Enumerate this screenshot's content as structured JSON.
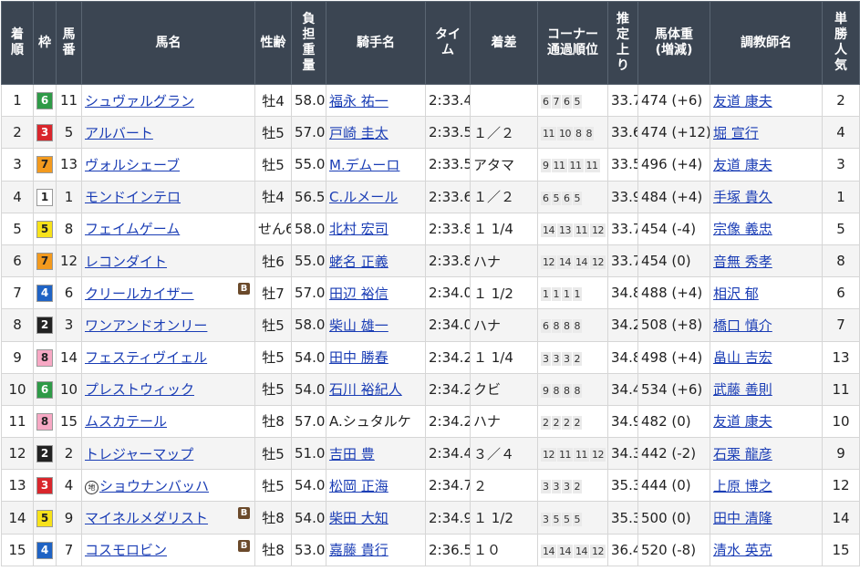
{
  "headers": [
    {
      "key": "rank",
      "lines": [
        "着",
        "順"
      ]
    },
    {
      "key": "waku",
      "lines": [
        "枠"
      ]
    },
    {
      "key": "umaban",
      "lines": [
        "馬",
        "番"
      ]
    },
    {
      "key": "horse",
      "lines": [
        "馬名"
      ]
    },
    {
      "key": "sexage",
      "lines": [
        "性齢"
      ]
    },
    {
      "key": "weight",
      "lines": [
        "負",
        "担",
        "重",
        "量"
      ]
    },
    {
      "key": "jockey",
      "lines": [
        "騎手名"
      ]
    },
    {
      "key": "time",
      "lines": [
        "タイ",
        "ム"
      ]
    },
    {
      "key": "margin",
      "lines": [
        "着差"
      ]
    },
    {
      "key": "corner",
      "lines": [
        "コーナー",
        "通過順位"
      ]
    },
    {
      "key": "last3f",
      "lines": [
        "推",
        "定",
        "上",
        "り"
      ]
    },
    {
      "key": "bodyweight",
      "lines": [
        "馬体重",
        "(増減)"
      ]
    },
    {
      "key": "trainer",
      "lines": [
        "調教師名"
      ]
    },
    {
      "key": "popularity",
      "lines": [
        "単",
        "勝",
        "人",
        "気"
      ]
    }
  ],
  "waku_colors": {
    "1": {
      "bg": "#ffffff",
      "fg": "#222222"
    },
    "2": {
      "bg": "#222222",
      "fg": "#ffffff"
    },
    "3": {
      "bg": "#d9262c",
      "fg": "#ffffff"
    },
    "4": {
      "bg": "#1f63c4",
      "fg": "#ffffff"
    },
    "5": {
      "bg": "#f7e21a",
      "fg": "#222222"
    },
    "6": {
      "bg": "#2e9a47",
      "fg": "#ffffff"
    },
    "7": {
      "bg": "#f39a1e",
      "fg": "#222222"
    },
    "8": {
      "bg": "#f7a8c4",
      "fg": "#222222"
    }
  },
  "rows": [
    {
      "rank": "1",
      "waku": "6",
      "umaban": "11",
      "horse": "シュヴァルグラン",
      "marker": "",
      "badge": "",
      "sexage": "牡4",
      "weight": "58.0",
      "jockey": "福永 祐一",
      "jockey_link": true,
      "time": "2:33.4",
      "margin": "",
      "corner": [
        "6",
        "7",
        "6",
        "5"
      ],
      "last3f": "33.7",
      "bodyweight": "474 (+6)",
      "trainer": "友道 康夫",
      "popularity": "2"
    },
    {
      "rank": "2",
      "waku": "3",
      "umaban": "5",
      "horse": "アルバート",
      "marker": "",
      "badge": "",
      "sexage": "牡5",
      "weight": "57.0",
      "jockey": "戸崎 圭太",
      "jockey_link": true,
      "time": "2:33.5",
      "margin": "１／２",
      "corner": [
        "11",
        "10",
        "8",
        "8"
      ],
      "last3f": "33.6",
      "bodyweight": "474 (+12)",
      "trainer": "堀 宣行",
      "popularity": "4"
    },
    {
      "rank": "3",
      "waku": "7",
      "umaban": "13",
      "horse": "ヴォルシェーブ",
      "marker": "",
      "badge": "",
      "sexage": "牡5",
      "weight": "55.0",
      "jockey": "M.デムーロ",
      "jockey_link": true,
      "time": "2:33.5",
      "margin": "アタマ",
      "corner": [
        "9",
        "11",
        "11",
        "11"
      ],
      "last3f": "33.5",
      "bodyweight": "496 (+4)",
      "trainer": "友道 康夫",
      "popularity": "3"
    },
    {
      "rank": "4",
      "waku": "1",
      "umaban": "1",
      "horse": "モンドインテロ",
      "marker": "",
      "badge": "",
      "sexage": "牡4",
      "weight": "56.5",
      "jockey": "C.ルメール",
      "jockey_link": true,
      "time": "2:33.6",
      "margin": "１／２",
      "corner": [
        "6",
        "5",
        "6",
        "5"
      ],
      "last3f": "33.9",
      "bodyweight": "484 (+4)",
      "trainer": "手塚 貴久",
      "popularity": "1"
    },
    {
      "rank": "5",
      "waku": "5",
      "umaban": "8",
      "horse": "フェイムゲーム",
      "marker": "",
      "badge": "",
      "sexage": "せん6",
      "weight": "58.0",
      "jockey": "北村 宏司",
      "jockey_link": true,
      "time": "2:33.8",
      "margin": "１ 1/4",
      "corner": [
        "14",
        "13",
        "11",
        "12"
      ],
      "last3f": "33.7",
      "bodyweight": "454 (-4)",
      "trainer": "宗像 義忠",
      "popularity": "5"
    },
    {
      "rank": "6",
      "waku": "7",
      "umaban": "12",
      "horse": "レコンダイト",
      "marker": "",
      "badge": "",
      "sexage": "牡6",
      "weight": "55.0",
      "jockey": "蛯名 正義",
      "jockey_link": true,
      "time": "2:33.8",
      "margin": "ハナ",
      "corner": [
        "12",
        "14",
        "14",
        "12"
      ],
      "last3f": "33.7",
      "bodyweight": "454 (0)",
      "trainer": "音無 秀孝",
      "popularity": "8"
    },
    {
      "rank": "7",
      "waku": "4",
      "umaban": "6",
      "horse": "クリールカイザー",
      "marker": "",
      "badge": "B",
      "sexage": "牡7",
      "weight": "57.0",
      "jockey": "田辺 裕信",
      "jockey_link": true,
      "time": "2:34.0",
      "margin": "１ 1/2",
      "corner": [
        "1",
        "1",
        "1",
        "1"
      ],
      "last3f": "34.8",
      "bodyweight": "488 (+4)",
      "trainer": "相沢 郁",
      "popularity": "6"
    },
    {
      "rank": "8",
      "waku": "2",
      "umaban": "3",
      "horse": "ワンアンドオンリー",
      "marker": "",
      "badge": "",
      "sexage": "牡5",
      "weight": "58.0",
      "jockey": "柴山 雄一",
      "jockey_link": true,
      "time": "2:34.0",
      "margin": "ハナ",
      "corner": [
        "6",
        "8",
        "8",
        "8"
      ],
      "last3f": "34.2",
      "bodyweight": "508 (+8)",
      "trainer": "橋口 慎介",
      "popularity": "7"
    },
    {
      "rank": "9",
      "waku": "8",
      "umaban": "14",
      "horse": "フェスティヴイェル",
      "marker": "",
      "badge": "",
      "sexage": "牡5",
      "weight": "54.0",
      "jockey": "田中 勝春",
      "jockey_link": true,
      "time": "2:34.2",
      "margin": "１ 1/4",
      "corner": [
        "3",
        "3",
        "3",
        "2"
      ],
      "last3f": "34.8",
      "bodyweight": "498 (+4)",
      "trainer": "畠山 吉宏",
      "popularity": "13"
    },
    {
      "rank": "10",
      "waku": "6",
      "umaban": "10",
      "horse": "プレストウィック",
      "marker": "",
      "badge": "",
      "sexage": "牡5",
      "weight": "54.0",
      "jockey": "石川 裕紀人",
      "jockey_link": true,
      "time": "2:34.2",
      "margin": "クビ",
      "corner": [
        "9",
        "8",
        "8",
        "8"
      ],
      "last3f": "34.4",
      "bodyweight": "534 (+6)",
      "trainer": "武藤 善則",
      "popularity": "11"
    },
    {
      "rank": "11",
      "waku": "8",
      "umaban": "15",
      "horse": "ムスカテール",
      "marker": "",
      "badge": "",
      "sexage": "牡8",
      "weight": "57.0",
      "jockey": "A.シュタルケ",
      "jockey_link": false,
      "time": "2:34.2",
      "margin": "ハナ",
      "corner": [
        "2",
        "2",
        "2",
        "2"
      ],
      "last3f": "34.9",
      "bodyweight": "482 (0)",
      "trainer": "友道 康夫",
      "popularity": "10"
    },
    {
      "rank": "12",
      "waku": "2",
      "umaban": "2",
      "horse": "トレジャーマップ",
      "marker": "",
      "badge": "",
      "sexage": "牡5",
      "weight": "51.0",
      "jockey": "吉田 豊",
      "jockey_link": true,
      "time": "2:34.4",
      "margin": "３／４",
      "corner": [
        "12",
        "11",
        "11",
        "12"
      ],
      "last3f": "34.3",
      "bodyweight": "442 (-2)",
      "trainer": "石栗 龍彦",
      "popularity": "9"
    },
    {
      "rank": "13",
      "waku": "3",
      "umaban": "4",
      "horse": "ショウナンバッハ",
      "marker": "地",
      "badge": "",
      "sexage": "牡5",
      "weight": "54.0",
      "jockey": "松岡 正海",
      "jockey_link": true,
      "time": "2:34.7",
      "margin": "２",
      "corner": [
        "3",
        "3",
        "3",
        "2"
      ],
      "last3f": "35.3",
      "bodyweight": "444 (0)",
      "trainer": "上原 博之",
      "popularity": "12"
    },
    {
      "rank": "14",
      "waku": "5",
      "umaban": "9",
      "horse": "マイネルメダリスト",
      "marker": "",
      "badge": "B",
      "sexage": "牡8",
      "weight": "54.0",
      "jockey": "柴田 大知",
      "jockey_link": true,
      "time": "2:34.9",
      "margin": "１ 1/2",
      "corner": [
        "3",
        "5",
        "5",
        "5"
      ],
      "last3f": "35.3",
      "bodyweight": "500 (0)",
      "trainer": "田中 清隆",
      "popularity": "14"
    },
    {
      "rank": "15",
      "waku": "4",
      "umaban": "7",
      "horse": "コスモロビン",
      "marker": "",
      "badge": "B",
      "sexage": "牡8",
      "weight": "53.0",
      "jockey": "嘉藤 貴行",
      "jockey_link": true,
      "time": "2:36.5",
      "margin": "１０",
      "corner": [
        "14",
        "14",
        "14",
        "12"
      ],
      "last3f": "36.4",
      "bodyweight": "520 (-8)",
      "trainer": "清水 英克",
      "popularity": "15"
    }
  ]
}
